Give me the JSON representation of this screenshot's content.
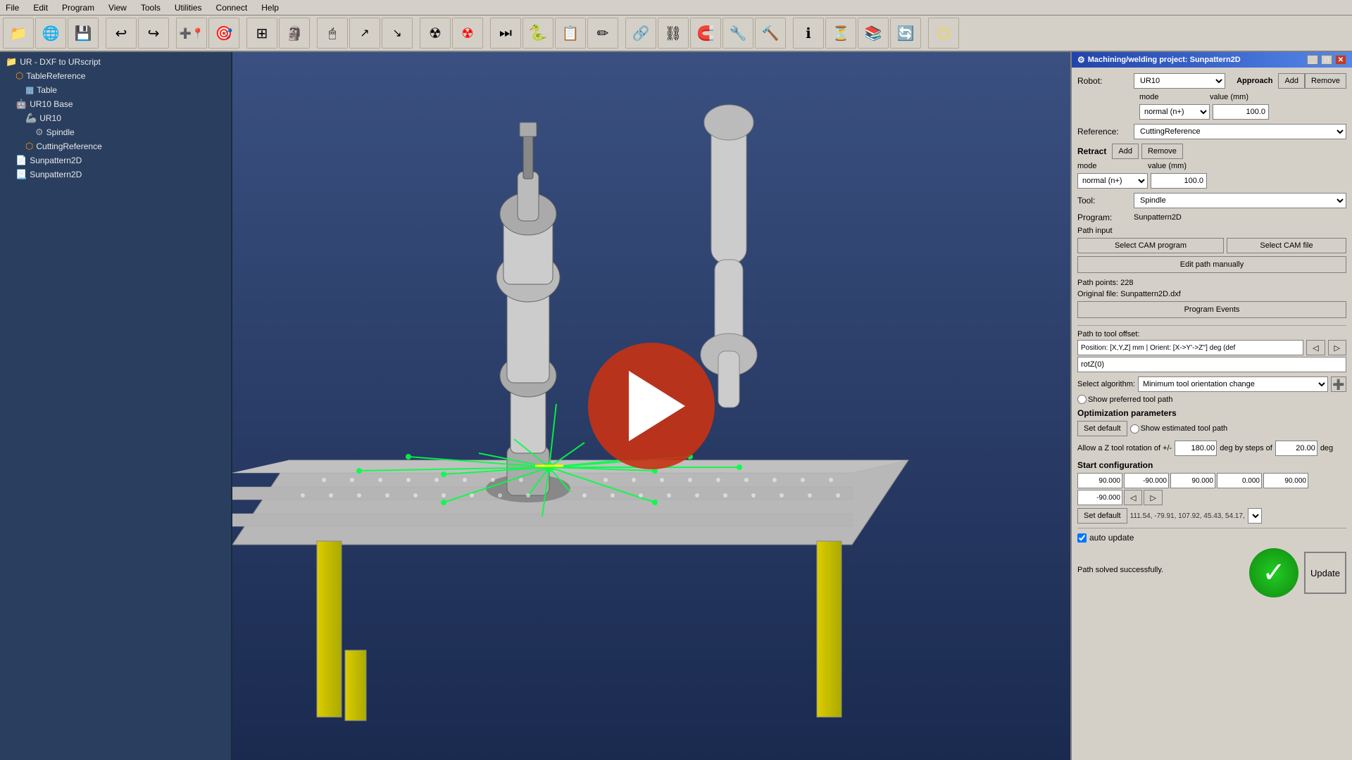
{
  "menubar": {
    "items": [
      "File",
      "Edit",
      "Program",
      "View",
      "Tools",
      "Utilities",
      "Connect",
      "Help"
    ]
  },
  "window_title": "UR - DXF to URscript",
  "tree": {
    "items": [
      {
        "label": "UR - DXF to URscript",
        "indent": 0,
        "icon": "folder"
      },
      {
        "label": "TableReference",
        "indent": 1,
        "icon": "ref"
      },
      {
        "label": "Table",
        "indent": 2,
        "icon": "table"
      },
      {
        "label": "UR10 Base",
        "indent": 1,
        "icon": "robot"
      },
      {
        "label": "UR10",
        "indent": 2,
        "icon": "robot-arm"
      },
      {
        "label": "Spindle",
        "indent": 3,
        "icon": "gear"
      },
      {
        "label": "CuttingReference",
        "indent": 2,
        "icon": "ref"
      },
      {
        "label": "Sunpattern2D",
        "indent": 1,
        "icon": "program"
      },
      {
        "label": "Sunpattern2D",
        "indent": 1,
        "icon": "file"
      }
    ]
  },
  "dialog": {
    "title": "Machining/welding project: Sunpattern2D",
    "robot_label": "Robot:",
    "robot_value": "UR10",
    "reference_label": "Reference:",
    "reference_value": "CuttingReference",
    "tool_label": "Tool:",
    "tool_value": "Spindle",
    "program_label": "Program:",
    "program_value": "Sunpattern2D",
    "path_input_label": "Path input",
    "btn_select_cam_program": "Select CAM program",
    "btn_select_cam_file": "Select CAM file",
    "btn_edit_path": "Edit path manually",
    "path_points": "Path points: 228",
    "original_file": "Original file: Sunpattern2D.dxf",
    "btn_program_events": "Program Events",
    "approach_label": "Approach",
    "add_label": "Add",
    "remove_label": "Remove",
    "mode_label": "mode",
    "value_mm_label": "value (mm)",
    "approach_mode": "normal (n+)",
    "approach_value": "100.0",
    "retract_label": "Retract",
    "retract_mode": "normal (n+)",
    "retract_value": "100.0",
    "path_to_tool_offset_label": "Path to tool offset:",
    "path_offset_value": "Position: [X,Y,Z] mm | Orient: [X->Y'->Z''] deg (def",
    "path_offset_value2": "rotZ(0)",
    "select_algorithm_label": "Select algorithm:",
    "algorithm_value": "Minimum tool orientation change",
    "show_preferred_tool_label": "Show preferred tool path",
    "optimization_params_label": "Optimization parameters",
    "btn_set_default": "Set default",
    "show_estimated_label": "Show estimated tool path",
    "allow_z_label": "Allow a Z tool rotation of +/-",
    "allow_z_value": "180.00",
    "deg_by_steps_label": "deg by steps of",
    "deg_steps_value": "20.00",
    "deg_label": "deg",
    "start_config_label": "Start configuration",
    "config_values": [
      "90.000",
      "-90.000",
      "90.000",
      "0.000",
      "90.000",
      "-90.000"
    ],
    "btn_set_default2": "Set default",
    "config_result": "111.54,    -79.91,    107.92,    45.43,    54.17,",
    "auto_update_label": "auto update",
    "success_message": "Path solved successfully.",
    "btn_update": "Update"
  }
}
